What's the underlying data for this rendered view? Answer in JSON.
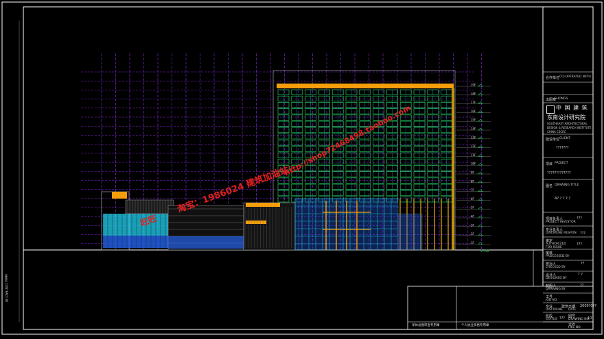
{
  "colors": {
    "background": "#000000",
    "frame": "#ffffff",
    "grid_line": "#8a2be2",
    "green_facade": "#22c55e",
    "cyan_glass": "#22d3ee",
    "blue_glass": "#2563eb",
    "orange_roof": "#f59e0b",
    "yellow_column": "#eab308",
    "watermark_red": "#e11d24"
  },
  "title_block": {
    "hint_label": "",
    "cooperate_label": "合作单位",
    "cooperate_en": "CO-OPERATED WITH",
    "seal_label": "出图章",
    "seal_en": "SHONGS",
    "logo_cn_line1": "中 国 建 筑",
    "logo_cn_line2": "东南设计研究院",
    "logo_en_line1": "SOUTHEAST ARCHITECTURAL",
    "logo_en_line2": "DESIGN & RESEARCH INSTITUTE",
    "logo_en_line3": "CHINA CSCEC",
    "client_label": "建设单位",
    "client_en": "CLIENT",
    "client_value": "???????",
    "project_label": "项目",
    "project_en": "PROJECT",
    "project_value": "?????????????",
    "drawing_title_label": "图名",
    "drawing_title_en": "DRAWING TITLE",
    "drawing_title_value": "A? ? ? ? ?",
    "investor_label": "项目负责人",
    "investor_en": "PROJECT INVESTOR",
    "investor_value": "???",
    "specialty_label": "专业负责人",
    "specialty_en": "DISCIPLINE RESPON",
    "specialty_value": "???",
    "authorized_label": "审定",
    "authorized_en": "AUTHORIZED FOR ISSUE",
    "authorized_value": "???",
    "processed_label": "审核",
    "processed_en": "PROCESSED BY",
    "checked_label": "校对人",
    "checked_en": "CHECKED BY",
    "checked_value": "??",
    "designed_label": "设计人",
    "designed_en": "DESIGNED BY",
    "designed_value": "?  ?",
    "drawn_label": "制图人",
    "drawn_en": "DRAWING BY",
    "drawn_value": "??",
    "job_label": "工号",
    "job_en": "JOB NO.",
    "discipline_label": "专业",
    "discipline_en": "DISCIPLINE",
    "discipline_value": "建筑",
    "date_label": "日期",
    "date_en": "DATE",
    "date_value": "2009?0??",
    "status_label": "阶段",
    "status_en": "STATUS",
    "status_value": "???",
    "drawing_no_label": "图号",
    "drawing_no_en": "DRAWING NO.",
    "drawing_no_value": "10",
    "file_label": "文件",
    "file_en": "FILE NO."
  },
  "bottom_strip": {
    "left_label": "单体总图审查专用章",
    "right_label": "个人执业资格专用章"
  },
  "left_edge_label": "会签栏 CONTRACT BY",
  "watermarks": [
    "淘宝：1986024  建筑加油站：",
    "http://shop72468498.taobao.com",
    "旺旺"
  ],
  "level_labels": [
    "19F",
    "18F",
    "17F",
    "16F",
    "15F",
    "14F",
    "13F",
    "12F",
    "11F",
    "10F",
    "9F",
    "8F",
    "7F",
    "6F",
    "5F",
    "4F",
    "3F",
    "2F",
    "1F"
  ],
  "ground_label": "-0.450"
}
